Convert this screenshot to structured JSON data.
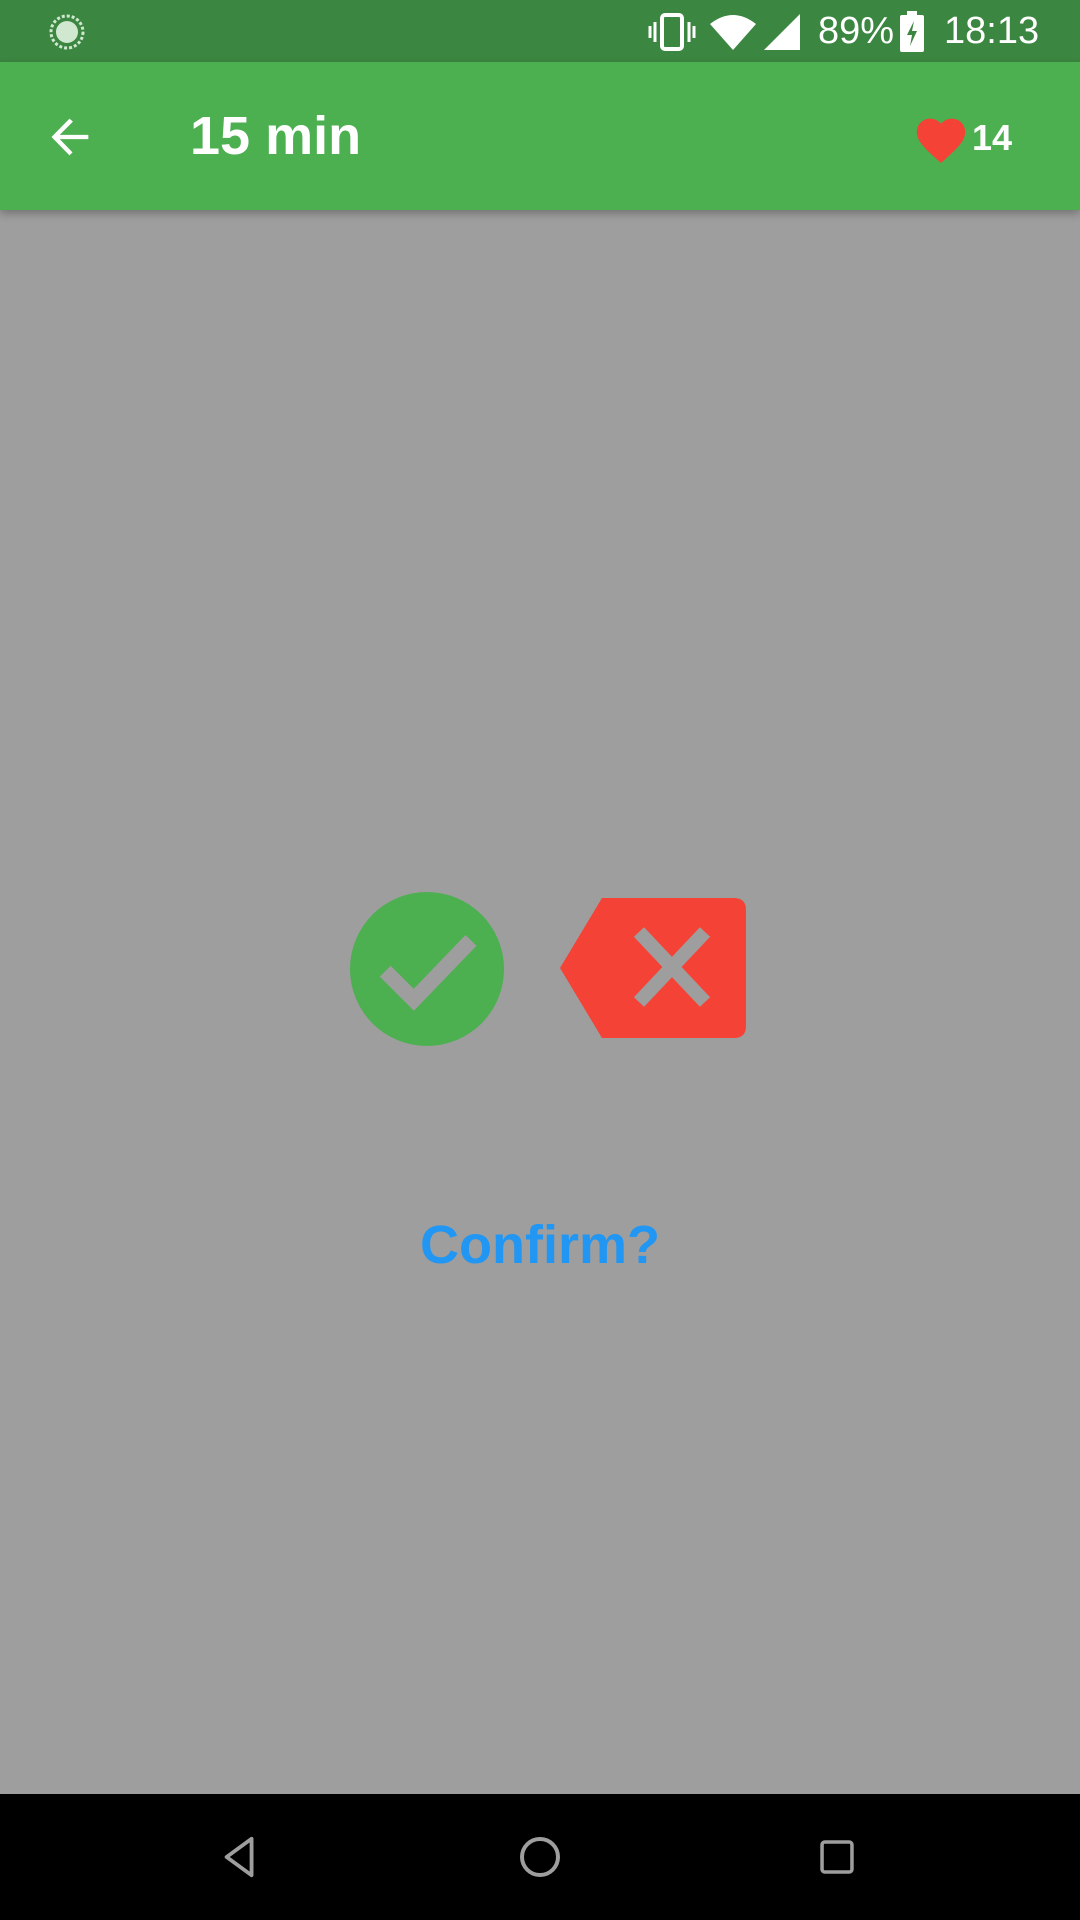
{
  "status_bar": {
    "battery_percent": "89%",
    "time": "18:13",
    "icons": [
      "app-notification-icon",
      "vibrate-icon",
      "wifi-icon",
      "cell-signal-icon",
      "battery-charging-icon"
    ]
  },
  "app_bar": {
    "title": "15 min",
    "lives_count": "14",
    "icons": [
      "back-arrow-icon",
      "heart-icon"
    ]
  },
  "dialog": {
    "prompt": "Confirm?",
    "icons": [
      "checkmark-icon",
      "backspace-x-icon"
    ]
  },
  "nav_bar": {
    "icons": [
      "nav-back-icon",
      "nav-home-icon",
      "nav-recents-icon"
    ]
  },
  "colors": {
    "status_bar": "#3b8640",
    "app_bar": "#4caf50",
    "background": "#9e9e9e",
    "confirm": "#4caf50",
    "cancel": "#f44336",
    "prompt": "#2196f3",
    "heart": "#f44336"
  }
}
